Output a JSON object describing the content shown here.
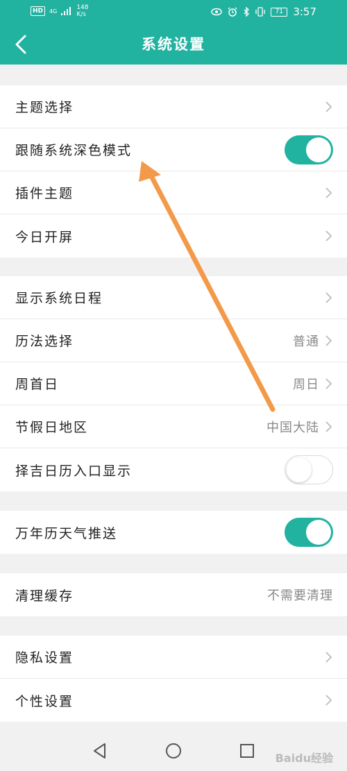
{
  "status_bar": {
    "hd": "HD",
    "network": "4G",
    "speed_value": "148",
    "speed_unit": "K/s",
    "battery": "71",
    "time": "3:57"
  },
  "navbar": {
    "title": "系统设置"
  },
  "groups": [
    {
      "items": [
        {
          "label": "主题选择",
          "type": "chevron"
        },
        {
          "label": "跟随系统深色模式",
          "type": "toggle",
          "toggle_on": true
        },
        {
          "label": "插件主题",
          "type": "chevron"
        },
        {
          "label": "今日开屏",
          "type": "chevron"
        }
      ]
    },
    {
      "items": [
        {
          "label": "显示系统日程",
          "type": "chevron"
        },
        {
          "label": "历法选择",
          "type": "chevron",
          "value": "普通"
        },
        {
          "label": "周首日",
          "type": "chevron",
          "value": "周日"
        },
        {
          "label": "节假日地区",
          "type": "chevron",
          "value": "中国大陆"
        },
        {
          "label": "择吉日历入口显示",
          "type": "toggle",
          "toggle_on": false
        }
      ]
    },
    {
      "items": [
        {
          "label": "万年历天气推送",
          "type": "toggle",
          "toggle_on": true
        }
      ]
    },
    {
      "items": [
        {
          "label": "清理缓存",
          "type": "value",
          "value": "不需要清理"
        }
      ]
    },
    {
      "items": [
        {
          "label": "隐私设置",
          "type": "chevron"
        },
        {
          "label": "个性设置",
          "type": "chevron"
        }
      ]
    }
  ],
  "watermark": "Baidu经验",
  "colors": {
    "accent": "#22b2a0",
    "arrow": "#f39a4a"
  }
}
